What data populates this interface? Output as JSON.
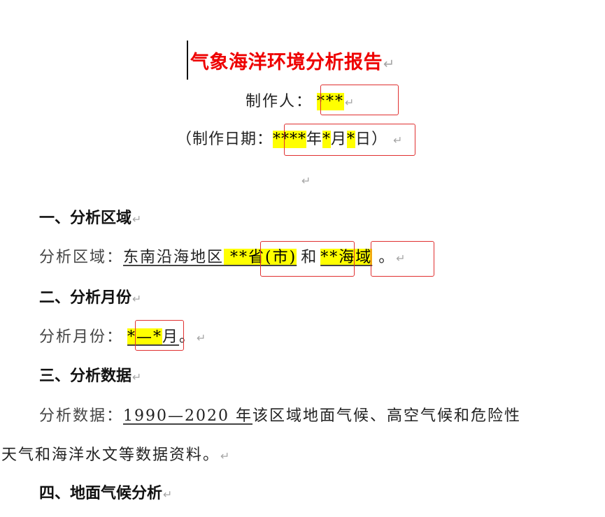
{
  "document": {
    "title": "气象海洋环境分析报告",
    "author_label": "制作人：",
    "author_value": "***",
    "date_open": "（制作日期：",
    "date_year": "****",
    "date_year_unit": "年",
    "date_month": "*",
    "date_month_unit": "月",
    "date_day": "*",
    "date_day_unit": "日",
    "date_close": "）"
  },
  "sections": [
    {
      "heading": "一、分析区域"
    },
    {
      "heading": "二、分析月份"
    },
    {
      "heading": "三、分析数据"
    },
    {
      "heading": "四、地面气候分析"
    }
  ],
  "region": {
    "label": "分析区域：",
    "area": "东南沿海地区",
    "province": " **省(市)",
    "conj": "和",
    "sea": "**海域",
    "tail": " 。"
  },
  "month": {
    "label": "分析月份：",
    "value": "*—*",
    "unit": "月",
    "tail": "。"
  },
  "data_para": {
    "label": "分析数据：",
    "years": "1990—2020 年",
    "line1_rest": "该区域地面气候、高空气候和危险性",
    "line2": "天气和海洋水文等数据资料。"
  },
  "marks": {
    "paragraph": "↵"
  }
}
